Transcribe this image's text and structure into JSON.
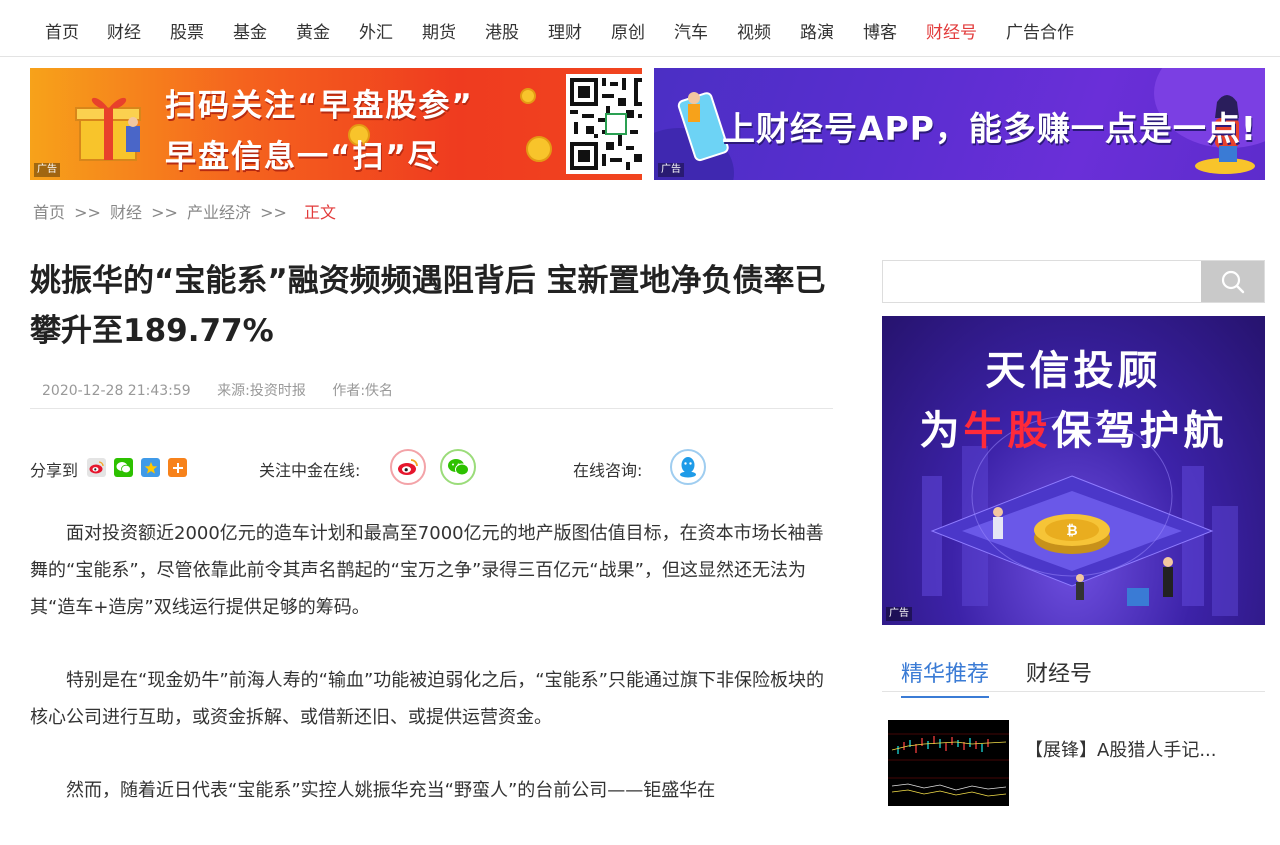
{
  "nav": {
    "items": [
      "首页",
      "财经",
      "股票",
      "基金",
      "黄金",
      "外汇",
      "期货",
      "港股",
      "理财",
      "原创",
      "汽车",
      "视频",
      "路演",
      "博客",
      "财经号",
      "广告合作"
    ],
    "active_index": 14,
    "active_color": "#e23a3a"
  },
  "banners": {
    "left": {
      "line1": "扫码关注“早盘股参”",
      "line2": "早盘信息一“扫”尽",
      "ad_tag": "广告"
    },
    "right": {
      "slogan": "上财经号APP，能多赚一点是一点!",
      "ad_tag": "广告"
    }
  },
  "breadcrumb": {
    "items": [
      "首页",
      "财经",
      "产业经济"
    ],
    "separator": ">>",
    "current": "正文"
  },
  "article": {
    "title": "姚振华的“宝能系”融资频频遇阻背后 宝新置地净负债率已攀升至189.77%",
    "date": "2020-12-28 21:43:59",
    "source": "来源:投资时报",
    "author": "作者:佚名",
    "share_label": "分享到",
    "follow_label": "关注中金在线:",
    "consult_label": "在线咨询:",
    "paragraphs": [
      "面对投资额近2000亿元的造车计划和最高至7000亿元的地产版图估值目标，在资本市场长袖善舞的“宝能系”，尽管依靠此前令其声名鹊起的“宝万之争”录得三百亿元“战果”，但这显然还无法为其“造车+造房”双线运行提供足够的筹码。",
      "特别是在“现金奶牛”前海人寿的“输血”功能被迫弱化之后，“宝能系”只能通过旗下非保险板块的核心公司进行互助，或资金拆解、或借新还旧、或提供运营资金。",
      "然而，随着近日代表“宝能系”实控人姚振华充当“野蛮人”的台前公司——钜盛华在"
    ]
  },
  "sidebar": {
    "search_placeholder": "",
    "ad": {
      "line1": "天信投顾",
      "line2_pre": "为",
      "line2_hl": "牛股",
      "line2_post": "保驾护航",
      "ad_tag": "广告"
    },
    "tabs": [
      "精华推荐",
      "财经号"
    ],
    "active_tab": 0,
    "accent_color": "#3a7bd5",
    "recommend": [
      {
        "title": "【展锋】A股猎人手记..."
      }
    ]
  },
  "icons": {
    "share": [
      "weibo-icon",
      "wechat-icon",
      "qzone-icon",
      "more-icon"
    ],
    "follow": [
      "weibo-icon",
      "wechat-icon"
    ],
    "consult": [
      "qq-icon"
    ],
    "search": "search-icon"
  }
}
